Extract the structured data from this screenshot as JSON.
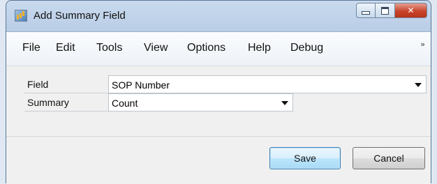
{
  "window": {
    "title": "Add Summary Field",
    "app_icon": "report-icon",
    "caption_icons": [
      "minimize-icon",
      "maximize-icon",
      "close-icon"
    ]
  },
  "menu": {
    "items": [
      "File",
      "Edit",
      "Tools",
      "View",
      "Options",
      "Help",
      "Debug"
    ],
    "overflow_icon": "chevron-double-right-icon",
    "overflow_glyph": "»"
  },
  "form": {
    "field_label": "Field",
    "field_value": "SOP Number",
    "summary_label": "Summary",
    "summary_value": "Count"
  },
  "buttons": {
    "save": "Save",
    "cancel": "Cancel"
  },
  "colors": {
    "title_bar": "#c9daee",
    "close_button": "#c9452c",
    "default_button_border": "#3c7fb1"
  }
}
